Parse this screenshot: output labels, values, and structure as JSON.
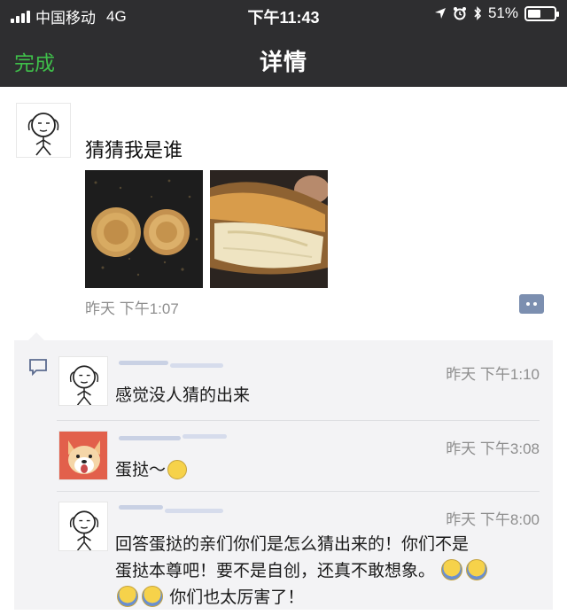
{
  "status_bar": {
    "carrier": "中国移动",
    "network": "4G",
    "time": "下午11:43",
    "battery_text": "51%",
    "battery_level": 0.51
  },
  "nav": {
    "back_label": "完成",
    "title": "详情"
  },
  "post": {
    "text": "猜猜我是谁",
    "time": "昨天 下午1:07",
    "images": [
      "photo-two-pastries",
      "photo-pastry-closeup"
    ]
  },
  "comments": [
    {
      "time": "昨天 下午1:10",
      "text": "感觉没人猜的出来",
      "avatar": "doodle-face"
    },
    {
      "time": "昨天 下午3:08",
      "text": "蛋挞～",
      "emoji": [
        "dizzy-face"
      ],
      "avatar": "shiba-dog"
    },
    {
      "time": "昨天 下午8:00",
      "line1": "回答蛋挞的亲们你们是怎么猜出来的！你们不是",
      "line2": "蛋挞本尊吧！要不是自创，还真不敢想象。",
      "line3": "你们也太厉害了！",
      "emoji": [
        "scream-face",
        "scream-face",
        "scream-face",
        "scream-face"
      ],
      "avatar": "doodle-face"
    }
  ],
  "colors": {
    "nav_background": "#2e2e30",
    "done_green": "#3fbf4a",
    "comments_background": "#f3f3f5",
    "muted_text": "#8e8e8e",
    "more_button": "#7c8fb0"
  }
}
